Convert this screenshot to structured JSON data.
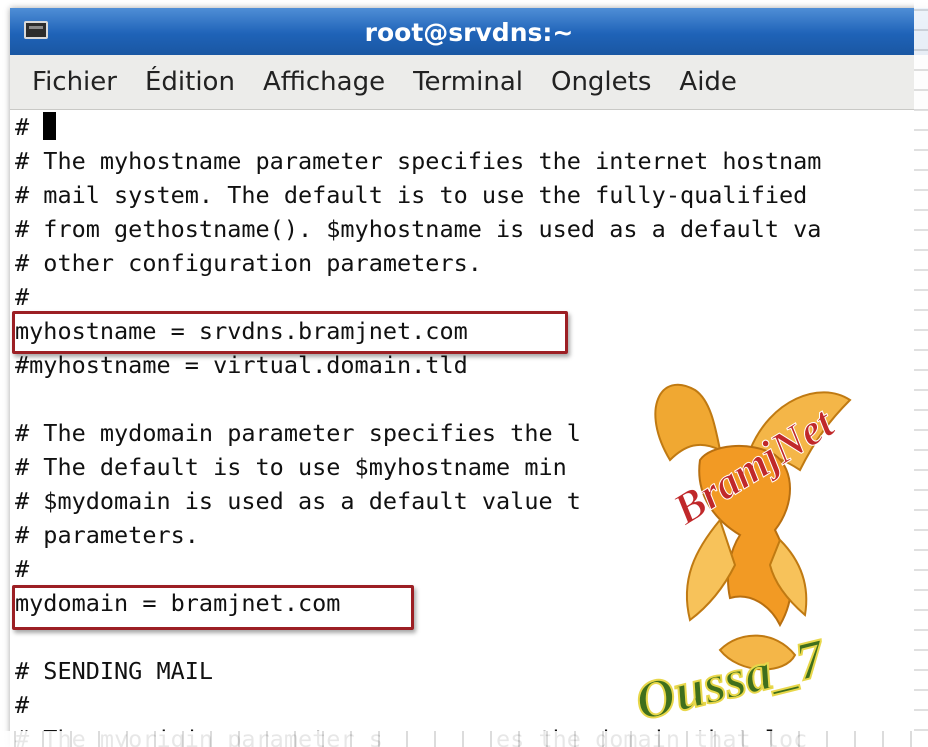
{
  "window": {
    "title": "root@srvdns:~"
  },
  "menubar": {
    "items": [
      "Fichier",
      "Édition",
      "Affichage",
      "Terminal",
      "Onglets",
      "Aide"
    ]
  },
  "terminal": {
    "lines": [
      "#",
      "# The myhostname parameter specifies the internet hostnam",
      "# mail system. The default is to use the fully-qualified",
      "# from gethostname(). $myhostname is used as a default va",
      "# other configuration parameters.",
      "#",
      "myhostname = srvdns.bramjnet.com",
      "#myhostname = virtual.domain.tld",
      "",
      "# The mydomain parameter specifies the l",
      "# The default is to use $myhostname min",
      "# $mydomain is used as a default value t",
      "# parameters.",
      "#",
      "mydomain = bramjnet.com",
      "",
      "# SENDING MAIL",
      "#",
      "# The myorigin parameter s        es the domain that loc"
    ]
  },
  "watermark": {
    "text_top": "BramjNet",
    "text_bottom": "Oussa_7",
    "colors": {
      "bird": "#f0a832",
      "top_text": "#c0282a",
      "bottom_text": "#3f6f1c"
    }
  }
}
